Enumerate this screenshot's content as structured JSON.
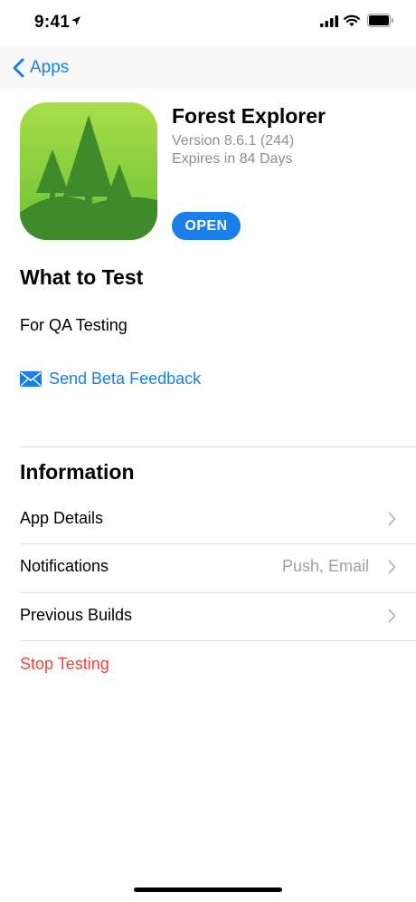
{
  "status_bar": {
    "time": "9:41"
  },
  "nav": {
    "back_label": "Apps"
  },
  "app": {
    "name": "Forest Explorer",
    "version": "Version 8.6.1 (244)",
    "expires": "Expires in 84 Days",
    "open_label": "OPEN",
    "icon": "forest-trees-icon"
  },
  "what_to_test": {
    "title": "What to Test",
    "body": "For QA Testing",
    "feedback_label": "Send Beta Feedback",
    "feedback_icon": "envelope-icon"
  },
  "information": {
    "title": "Information",
    "rows": [
      {
        "label": "App Details",
        "value": ""
      },
      {
        "label": "Notifications",
        "value": "Push, Email"
      },
      {
        "label": "Previous Builds",
        "value": ""
      }
    ],
    "stop_label": "Stop Testing"
  },
  "colors": {
    "accent": "#1a7fe8",
    "destructive": "#f0433a",
    "secondary_text": "#8e8e93"
  }
}
